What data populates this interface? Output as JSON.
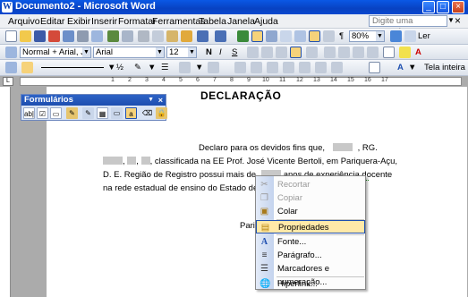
{
  "window": {
    "title": "Documento2 - Microsoft Word",
    "app_icon": "word-icon",
    "controls": [
      "minimize-icon",
      "maximize-icon",
      "close-icon"
    ]
  },
  "menubar": {
    "items": [
      "Arquivo",
      "Editar",
      "Exibir",
      "Inserir",
      "Formatar",
      "Ferramentas",
      "Tabela",
      "Janela",
      "Ajuda"
    ],
    "help_placeholder": "Digite uma pergunta",
    "close_doc": "×"
  },
  "toolbar_standard": {
    "zoom": "80%",
    "read_label": "Ler"
  },
  "toolbar_formatting": {
    "style": "Normal + Arial, Justi",
    "font": "Arial",
    "size": "12"
  },
  "toolbar_drawing": {
    "full_screen_label": "Tela inteira"
  },
  "ruler": {
    "ticks": [
      "1",
      "2",
      "3",
      "4",
      "5",
      "6",
      "7",
      "8",
      "9",
      "10",
      "11",
      "12",
      "13",
      "14",
      "15",
      "16",
      "17"
    ]
  },
  "forms_toolbar": {
    "title": "Formulários",
    "buttons": [
      "ab|"
    ]
  },
  "document": {
    "title": "DECLARAÇÃO",
    "line1_a": "Declaro para os devidos fins que,",
    "line1_b": ", RG.",
    "line2_b": ", classificada na EE Prof. José Vicente Bertoli, em Pariquera-Açu,",
    "line3_a": "D. E. Região de Registro possui mais de",
    "line3_b": "anos de experiência docente",
    "line4": "na rede estadual de ensino do Estado de São",
    "line5": "Pario"
  },
  "context_menu": {
    "items": [
      {
        "label": "Recortar",
        "icon": "scissors-icon",
        "disabled": true
      },
      {
        "label": "Copiar",
        "icon": "copy-icon",
        "disabled": true
      },
      {
        "label": "Colar",
        "icon": "paste-icon",
        "disabled": false
      },
      {
        "label": "Propriedades",
        "icon": "properties-icon",
        "disabled": false,
        "highlighted": true
      },
      {
        "label": "Fonte...",
        "icon": "font-icon",
        "disabled": false
      },
      {
        "label": "Parágrafo...",
        "icon": "paragraph-icon",
        "disabled": false
      },
      {
        "label": "Marcadores e numeração...",
        "icon": "bullets-icon",
        "disabled": false
      },
      {
        "label": "Hiperlink...",
        "icon": "hyperlink-icon",
        "disabled": false
      }
    ]
  },
  "colors": {
    "titlebar": "#0A49D0",
    "menu_highlight": "#FFE9A8",
    "highlight_border": "#2050B0",
    "redaction": "#C8C8C8"
  }
}
